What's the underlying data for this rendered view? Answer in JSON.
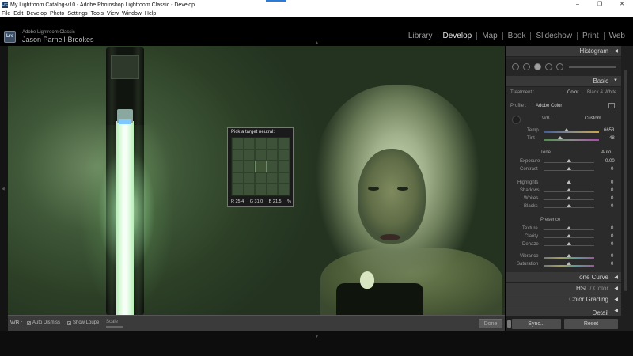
{
  "window": {
    "title": "My Lightroom Catalog-v10 - Adobe Photoshop Lightroom Classic - Develop",
    "app_icon": "Lrc",
    "controls": [
      "–",
      "❐",
      "✕"
    ]
  },
  "menu": [
    "File",
    "Edit",
    "Develop",
    "Photo",
    "Settings",
    "Tools",
    "View",
    "Window",
    "Help"
  ],
  "header": {
    "logo": "Lrc",
    "product": "Adobe Lightroom Classic",
    "user": "Jason Parnell-Brookes",
    "modules": [
      "Library",
      "Develop",
      "Map",
      "Book",
      "Slideshow",
      "Print",
      "Web"
    ],
    "active_module": "Develop"
  },
  "loupe": {
    "title": "Pick a target neutral:",
    "r": "R 25.4",
    "g": "G 31.0",
    "b": "B 21.5",
    "unit": "%"
  },
  "toolbar": {
    "wb": "WB :",
    "auto_dismiss": "Auto Dismiss",
    "show_loupe": "Show Loupe",
    "scale": "Scale",
    "done": "Done"
  },
  "panel": {
    "histogram": "Histogram",
    "basic": "Basic",
    "treatment_label": "Treatment :",
    "treatment_color": "Color",
    "treatment_bw": "Black & White",
    "profile_label": "Profile :",
    "profile_value": "Adobe Color",
    "wb_label": "WB :",
    "wb_value": "Custom",
    "temp_label": "Temp",
    "temp_value": "6653",
    "tint_label": "Tint",
    "tint_value": "– 48",
    "tone": "Tone",
    "auto": "Auto",
    "exposure_label": "Exposure",
    "exposure_value": "0.00",
    "contrast_label": "Contrast",
    "contrast_value": "0",
    "highlights_label": "Highlights",
    "highlights_value": "0",
    "shadows_label": "Shadows",
    "shadows_value": "0",
    "whites_label": "Whites",
    "whites_value": "0",
    "blacks_label": "Blacks",
    "blacks_value": "0",
    "presence": "Presence",
    "texture_label": "Texture",
    "texture_value": "0",
    "clarity_label": "Clarity",
    "clarity_value": "0",
    "dehaze_label": "Dehaze",
    "dehaze_value": "0",
    "vibrance_label": "Vibrance",
    "vibrance_value": "0",
    "saturation_label": "Saturation",
    "saturation_value": "0",
    "tone_curve": "Tone Curve",
    "hsl": "HSL",
    "hsl_sep": " / ",
    "hsl_color": "Color",
    "color_grading": "Color Grading",
    "detail": "Detail",
    "sync": "Sync...",
    "reset": "Reset"
  }
}
